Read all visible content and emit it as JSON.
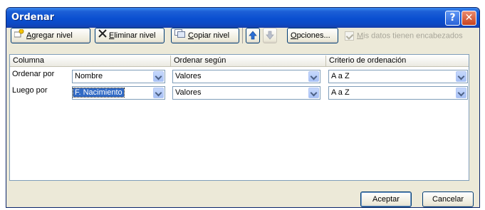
{
  "window": {
    "title": "Ordenar"
  },
  "titlebar": {
    "help_glyph": "?",
    "close_glyph": "✕"
  },
  "toolbar": {
    "add_level": {
      "accel": "A",
      "rest": "gregar nivel"
    },
    "delete_level": {
      "accel": "E",
      "rest": "liminar nivel"
    },
    "copy_level": {
      "accel": "C",
      "rest": "opiar nivel"
    },
    "options": {
      "accel": "O",
      "rest": "pciones..."
    },
    "headers_checkbox": {
      "accel": "M",
      "rest": "is datos tienen encabezados",
      "checked": true,
      "enabled": false
    }
  },
  "grid": {
    "headers": {
      "column": "Columna",
      "sort_on": "Ordenar según",
      "order": "Criterio de ordenación"
    },
    "rows": [
      {
        "label": "Ordenar por",
        "column": "Nombre",
        "sort_on": "Valores",
        "order": "A a Z",
        "selected": false
      },
      {
        "label": "Luego por",
        "column": "F. Nacimiento",
        "sort_on": "Valores",
        "order": "A a Z",
        "selected": true
      }
    ]
  },
  "footer": {
    "ok": "Aceptar",
    "cancel": "Cancelar"
  },
  "colors": {
    "titlebar": "#0a4fd0",
    "dialog_bg": "#ece9d8",
    "selection": "#316ac5"
  }
}
